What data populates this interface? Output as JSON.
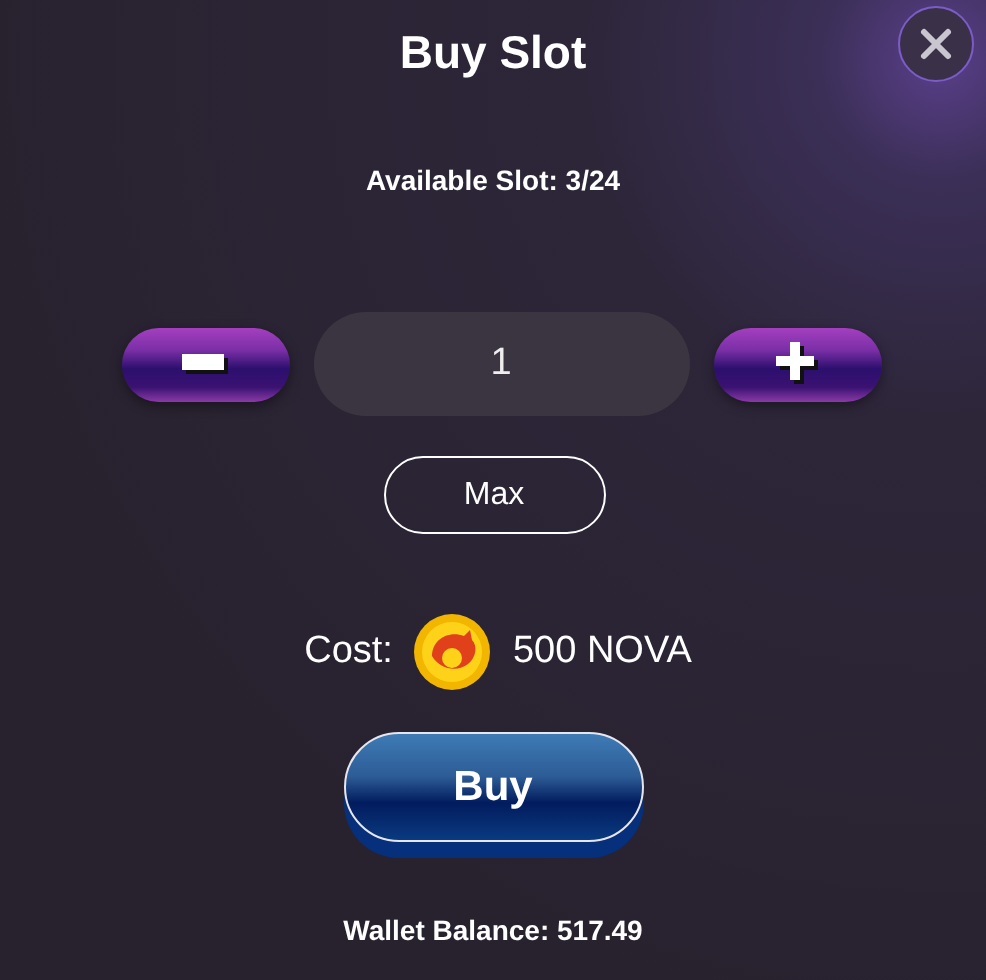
{
  "dialog": {
    "title": "Buy Slot"
  },
  "available_slots": "Available Slot: 3/24",
  "quantity": {
    "value": "1"
  },
  "max_button": "Max",
  "cost": {
    "label": "Cost:",
    "amount": "500 NOVA"
  },
  "buy_button": "Buy",
  "wallet_balance": "Wallet Balance: 517.49"
}
